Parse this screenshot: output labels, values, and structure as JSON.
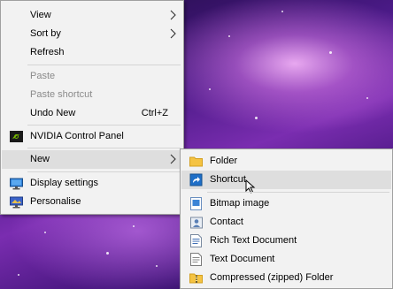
{
  "main_menu": {
    "view": "View",
    "sort_by": "Sort by",
    "refresh": "Refresh",
    "paste": "Paste",
    "paste_shortcut": "Paste shortcut",
    "undo_new": "Undo New",
    "undo_shortcut": "Ctrl+Z",
    "nvidia": "NVIDIA Control Panel",
    "new": "New",
    "display_settings": "Display settings",
    "personalise": "Personalise"
  },
  "sub_menu": {
    "folder": "Folder",
    "shortcut": "Shortcut",
    "bitmap": "Bitmap image",
    "contact": "Contact",
    "rich_text": "Rich Text Document",
    "text_doc": "Text Document",
    "compressed": "Compressed (zipped) Folder"
  },
  "colors": {
    "menu_bg": "#f2f2f2",
    "hover_bg": "#dedede",
    "disabled_text": "#8a8a8a",
    "nvidia_green": "#76b900"
  }
}
